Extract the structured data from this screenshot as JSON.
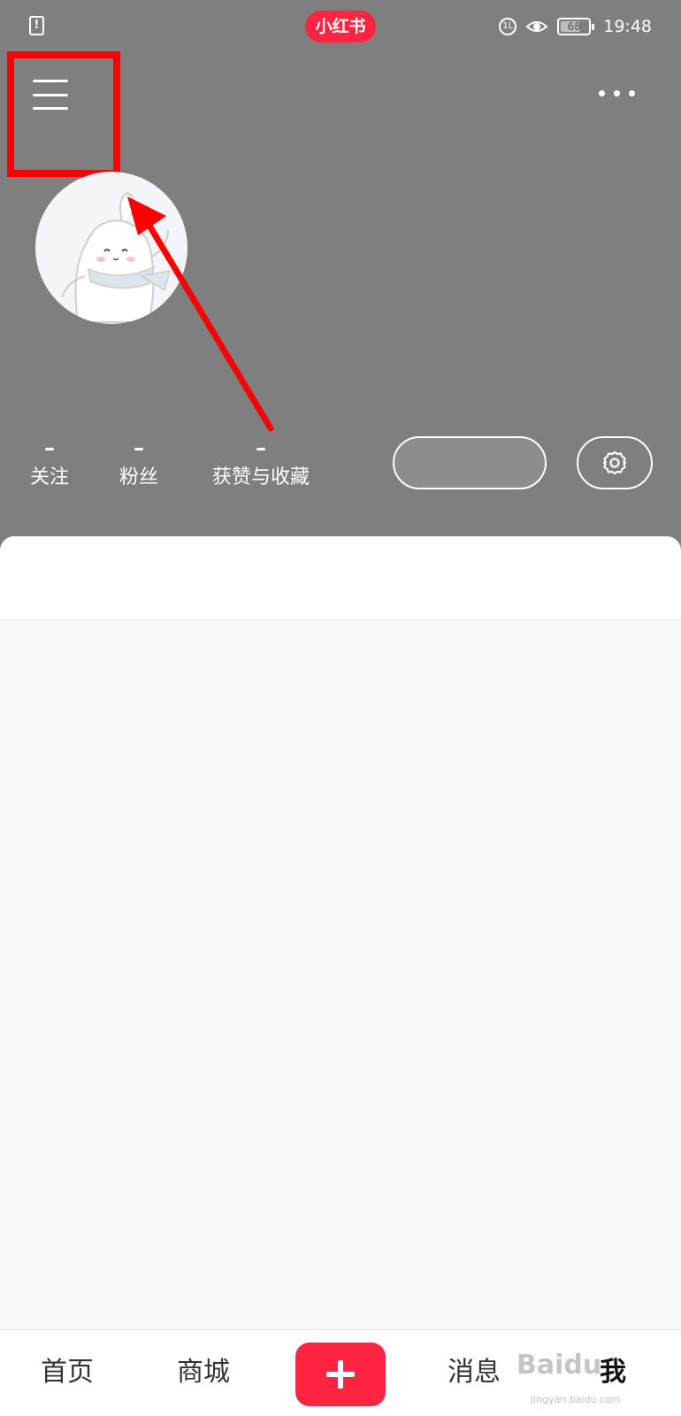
{
  "status_bar": {
    "app_badge": "小红书",
    "sim_icon": "sim-alert-icon",
    "network_badge": "1L",
    "battery_level": "68",
    "time": "19:48"
  },
  "header": {
    "menu_icon": "hamburger-menu-icon",
    "more_icon": "more-horizontal-icon",
    "avatar_icon": "default-avatar-illustration"
  },
  "stats": [
    {
      "value": "–",
      "label": "关注"
    },
    {
      "value": "–",
      "label": "粉丝"
    },
    {
      "value": "–",
      "label": "获赞与收藏"
    }
  ],
  "actions": {
    "edit_profile_label": "",
    "settings_icon": "gear-icon"
  },
  "bottom_nav": {
    "home": "首页",
    "mall": "商城",
    "add_icon": "plus-icon",
    "messages": "消息",
    "me": "我"
  },
  "watermark": {
    "text": "Baidu",
    "sub": "jingyan.baidu.com"
  },
  "colors": {
    "header_bg": "#7f7f7f",
    "brand_red": "#ff2442",
    "annotation_red": "#ff0000"
  }
}
